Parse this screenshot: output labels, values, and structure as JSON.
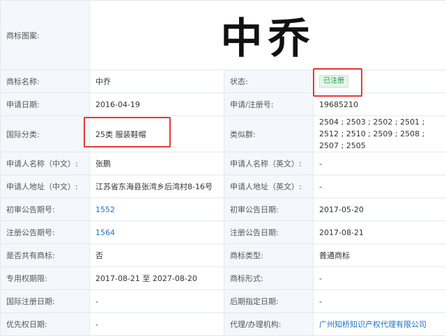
{
  "trademark": {
    "logo_label": "商标图案:",
    "logo_text": "中乔",
    "rows": [
      {
        "left_label": "商标名称:",
        "left_value": "中乔",
        "right_label": "状态:",
        "right_value": "已注册"
      },
      {
        "left_label": "申请日期:",
        "left_value": "2016-04-19",
        "right_label": "申请/注册号:",
        "right_value": "19685210"
      },
      {
        "left_label": "国际分类:",
        "left_value": "25类 服装鞋帽",
        "right_label": "类似群:",
        "right_value": "2504 ; 2503 ; 2502 ; 2501 ; 2512 ; 2510 ; 2509 ; 2508 ; 2507 ; 2505"
      },
      {
        "left_label": "申请人名称（中文）:",
        "left_value": "张鹏",
        "right_label": "申请人名称（英文）:",
        "right_value": "-"
      },
      {
        "left_label": "申请人地址（中文）:",
        "left_value": "江苏省东海县张湾乡后湾村8-16号",
        "right_label": "申请人地址（英文）:",
        "right_value": "-"
      },
      {
        "left_label": "初审公告期号:",
        "left_value": "1552",
        "right_label": "初审公告日期:",
        "right_value": "2017-05-20"
      },
      {
        "left_label": "注册公告期号:",
        "left_value": "1564",
        "right_label": "注册公告日期:",
        "right_value": "2017-08-21"
      },
      {
        "left_label": "是否共有商标:",
        "left_value": "否",
        "right_label": "商标类型:",
        "right_value": "普通商标"
      },
      {
        "left_label": "专用权期限:",
        "left_value": "2017-08-21 至 2027-08-20",
        "right_label": "商标形式:",
        "right_value": "-"
      },
      {
        "left_label": "国际注册日期:",
        "left_value": "-",
        "right_label": "后期指定日期:",
        "right_value": "-"
      },
      {
        "left_label": "优先权日期:",
        "left_value": "-",
        "right_label": "代理/办理机构:",
        "right_value": "广州知桥知识产权代理有限公司"
      }
    ]
  },
  "colors": {
    "label_bg": "#f4f7fb",
    "border": "#e3e8ee",
    "link": "#1a73c8",
    "status_green": "#1f9a45",
    "highlight_red": "#e53935"
  }
}
